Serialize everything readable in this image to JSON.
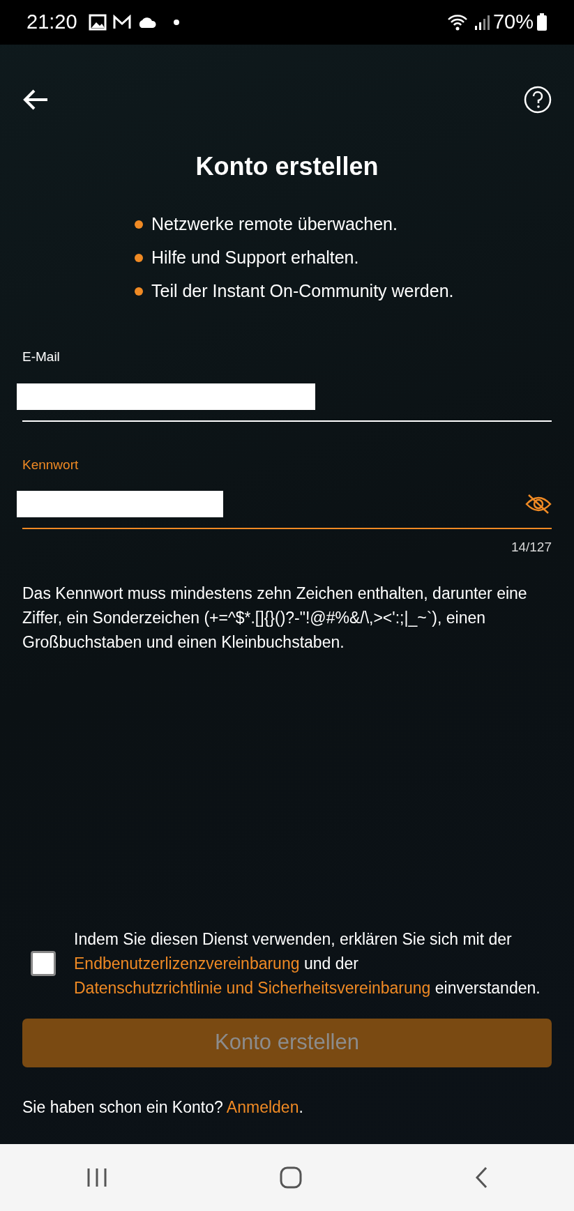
{
  "status_bar": {
    "time": "21:20",
    "battery": "70%"
  },
  "title": "Konto erstellen",
  "benefits": [
    "Netzwerke remote überwachen.",
    "Hilfe und Support erhalten.",
    "Teil der Instant On-Community werden."
  ],
  "fields": [
    {
      "label": "E-Mail",
      "focused": false,
      "redacted": true
    },
    {
      "label": "Kennwort",
      "focused": true,
      "redacted": true,
      "counter": "14/127"
    }
  ],
  "password_hint": "Das Kennwort muss mindestens zehn Zeichen enthalten, darunter eine Ziffer, ein Sonderzeichen (+=^$*.[]{}()?-\"!@#%&/\\,><':;|_~`), einen Großbuchstaben und einen Kleinbuchstaben.",
  "consent": {
    "checked": false,
    "parts": [
      {
        "kind": "text",
        "text": "Indem Sie diesen Dienst verwenden, erklären Sie sich mit der "
      },
      {
        "kind": "link",
        "text": "Endbenutzerlizenzvereinbarung"
      },
      {
        "kind": "text",
        "text": " und der "
      },
      {
        "kind": "link",
        "text": "Datenschutzrichtlinie und Sicherheitsvereinbarung"
      },
      {
        "kind": "text",
        "text": " einverstanden."
      }
    ]
  },
  "submit": {
    "label": "Konto erstellen",
    "disabled": true
  },
  "signin": [
    {
      "kind": "text",
      "text": "Sie haben schon ein Konto? "
    },
    {
      "kind": "link",
      "text": "Anmelden"
    },
    {
      "kind": "text",
      "text": "."
    }
  ]
}
